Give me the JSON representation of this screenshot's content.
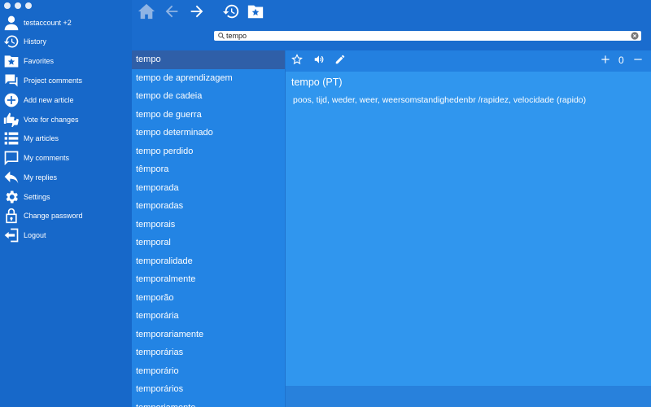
{
  "sidebar": {
    "account": {
      "label": "testaccount  +2",
      "icon": "user-icon"
    },
    "items": [
      {
        "label": "History",
        "icon": "history-icon"
      },
      {
        "label": "Favorites",
        "icon": "favorites-icon"
      },
      {
        "label": "Project comments",
        "icon": "comments-icon"
      },
      {
        "label": "Add new article",
        "icon": "add-icon"
      },
      {
        "label": "Vote for changes",
        "icon": "vote-icon"
      },
      {
        "label": "My articles",
        "icon": "list-icon"
      },
      {
        "label": "My comments",
        "icon": "comment-icon"
      },
      {
        "label": "My replies",
        "icon": "reply-icon"
      },
      {
        "label": "Settings",
        "icon": "gear-icon"
      },
      {
        "label": "Change password",
        "icon": "lock-icon"
      },
      {
        "label": "Logout",
        "icon": "logout-icon"
      }
    ]
  },
  "search": {
    "value": "tempo",
    "placeholder": ""
  },
  "wordlist": {
    "selected_index": 0,
    "items": [
      "tempo",
      "tempo de aprendizagem",
      "tempo de cadeia",
      "tempo de guerra",
      "tempo determinado",
      "tempo perdido",
      "têmpora",
      "temporada",
      "temporadas",
      "temporais",
      "temporal",
      "temporalidade",
      "temporalmente",
      "temporão",
      "temporária",
      "temporariamente",
      "temporárias",
      "temporário",
      "temporários",
      "temporiamente"
    ]
  },
  "article": {
    "title": "tempo (PT)",
    "translation": "poos, tijd, weder, weer, weersomstandighedenbr /rapidez, velocidade (rapido)",
    "vote_count": "0"
  },
  "colors": {
    "sidebar": "#1768c9",
    "list": "#2384e4",
    "selected": "#2f5fa8",
    "content": "#3096ee"
  }
}
